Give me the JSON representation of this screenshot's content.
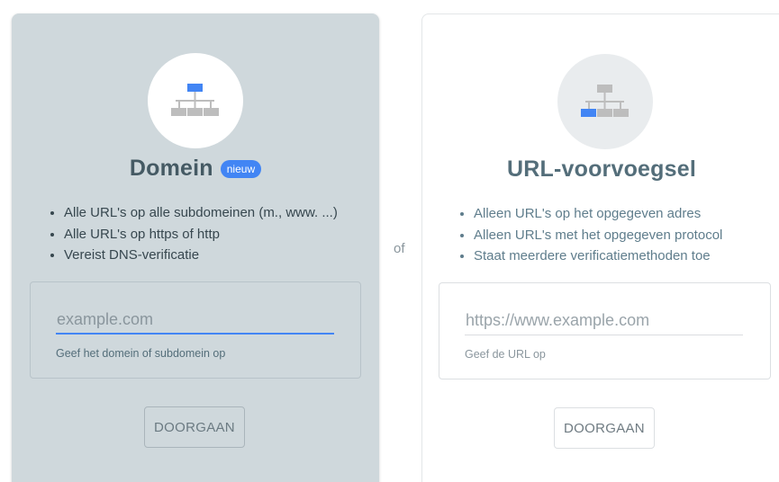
{
  "domain_card": {
    "title": "Domein",
    "badge": "nieuw",
    "features": [
      "Alle URL's op alle subdomeinen (m., www. ...)",
      "Alle URL's op https of http",
      "Vereist DNS-verificatie"
    ],
    "input_placeholder": "example.com",
    "input_value": "",
    "helper_text": "Geef het domein of subdomein op",
    "button_label": "DOORGAAN",
    "icon": "sitemap-icon"
  },
  "separator": "of",
  "url_card": {
    "title": "URL-voorvoegsel",
    "features": [
      "Alleen URL's op het opgegeven adres",
      "Alleen URL's met het opgegeven protocol",
      "Staat meerdere verificatiemethoden toe"
    ],
    "input_placeholder": "https://www.example.com",
    "input_value": "",
    "helper_text": "Geef de URL op",
    "button_label": "DOORGAAN",
    "icon": "sitemap-icon"
  },
  "colors": {
    "accent": "#4285f4",
    "icon_gray": "#bdbdbd",
    "domain_card_bg": "#cfd8dc"
  }
}
